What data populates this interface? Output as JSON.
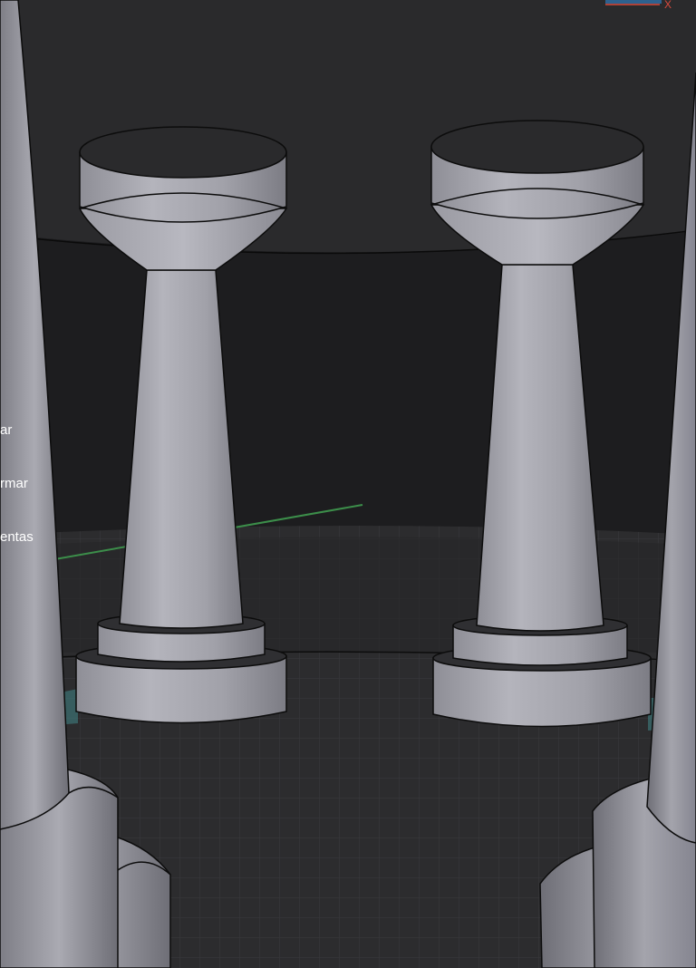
{
  "menu": {
    "items": [
      {
        "label": "ar"
      },
      {
        "label": "rmar"
      },
      {
        "label": "entas"
      }
    ]
  },
  "axis_gizmo": {
    "x_label": "X"
  },
  "colors": {
    "background_dark": "#1d1d1f",
    "ceiling": "#2a2a2c",
    "floor": "#2b2b2d",
    "pillar": "#a2a2aa",
    "axis_green": "#3c8e4a",
    "axis_red": "#d94a3d"
  },
  "icons": {
    "x_axis": "x-axis-icon"
  }
}
